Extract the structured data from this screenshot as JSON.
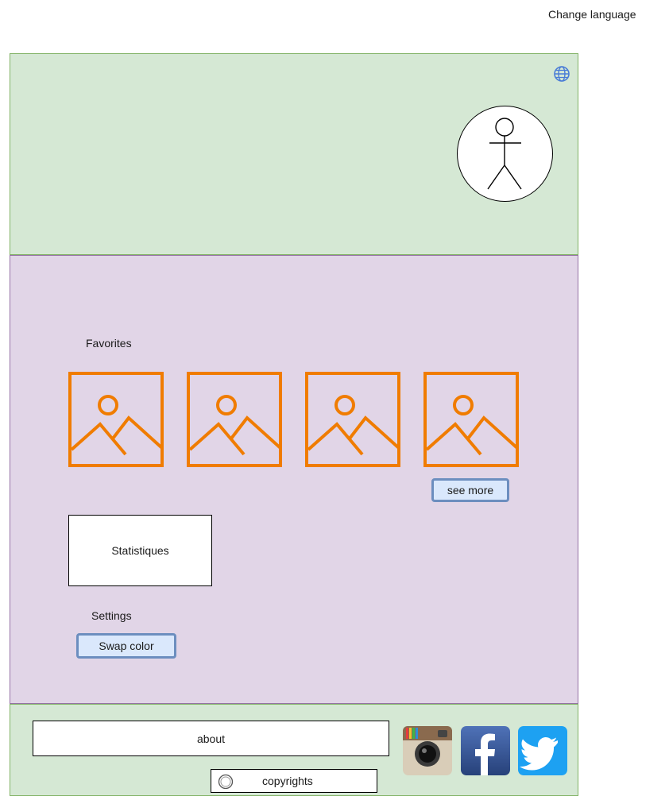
{
  "annotation": {
    "change_language": "Change language"
  },
  "icons": {
    "language": "globe-icon",
    "avatar": "stick-figure-icon",
    "image": "image-placeholder-icon",
    "copyright": "copyright-icon",
    "social": [
      "instagram-icon",
      "facebook-icon",
      "twitter-icon"
    ]
  },
  "favorites": {
    "label": "Favorites",
    "see_more": "see more",
    "count": 4
  },
  "statistics": {
    "label": "Statistiques"
  },
  "settings": {
    "label": "Settings",
    "swap_color": "Swap color"
  },
  "footer": {
    "about": "about",
    "copyrights": "copyrights"
  },
  "colors": {
    "header_bg": "#d5e8d4",
    "main_bg": "#e1d5e7",
    "image_orange": "#f07c00",
    "button_bg": "#dae8fc",
    "button_border": "#6c8ebf",
    "facebook": "#3b5998",
    "twitter": "#1da1f2"
  }
}
